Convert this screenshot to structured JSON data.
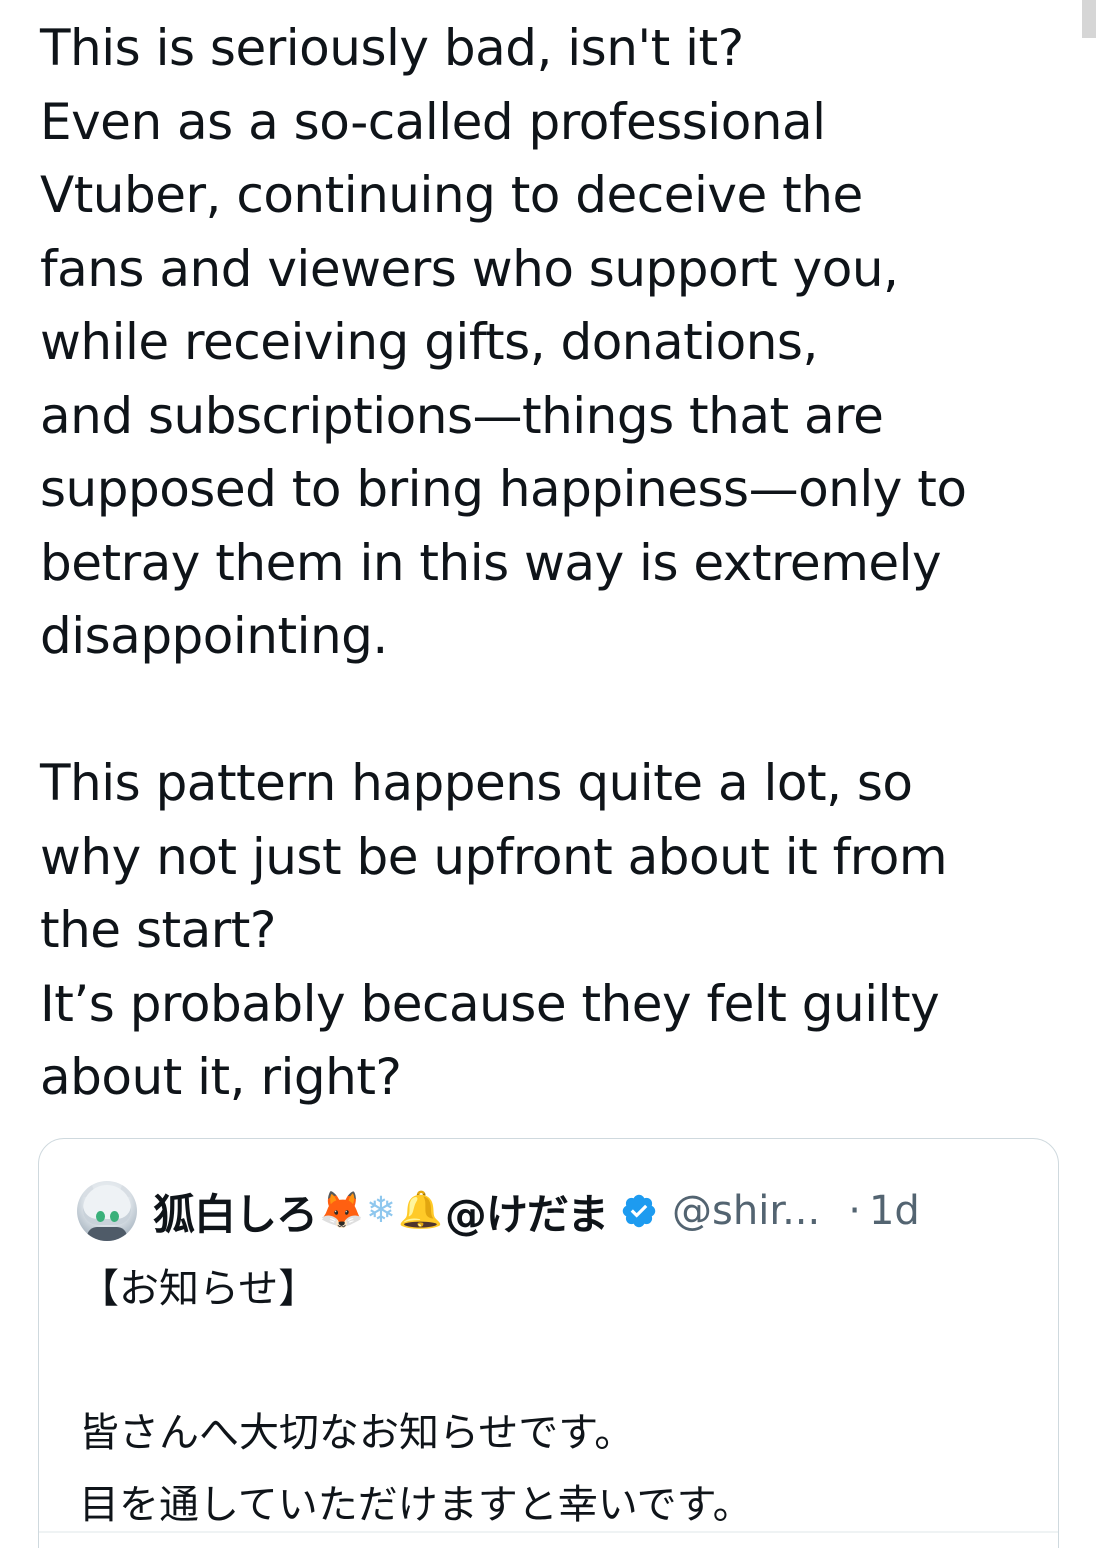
{
  "post": {
    "paragraph1_lines": [
      "This is seriously bad, isn't it?",
      "Even as a so-called professional",
      "Vtuber, continuing to deceive the",
      "fans and viewers who support you,",
      "while receiving gifts, donations,",
      "and subscriptions—things that are",
      "supposed to bring happiness—only to",
      "betray them in this way is extremely",
      "disappointing."
    ],
    "paragraph2_lines": [
      "This pattern happens quite a lot, so",
      "why not just be upfront about it from",
      "the start?",
      "It’s probably because they felt guilty",
      "about it, right?"
    ]
  },
  "quoted_post": {
    "display_name": "狐白しろ",
    "emojis": {
      "fox": "🦊",
      "snowflake": "❄",
      "bell": "🔔"
    },
    "name_suffix": "@けだま",
    "handle": "@shir...",
    "separator": "·",
    "time": "1d",
    "text_lines": [
      "【お知らせ】",
      "皆さんへ大切なお知らせです。",
      "目を通していただけますと幸いです。"
    ],
    "verified_color": "#1d9bf0"
  }
}
